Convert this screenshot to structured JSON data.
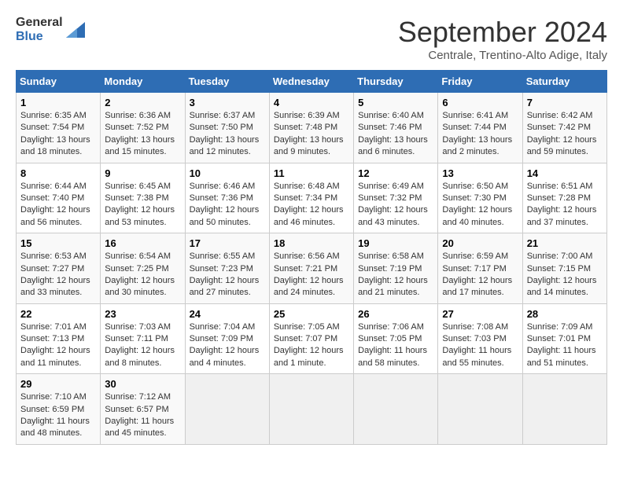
{
  "header": {
    "logo_line1": "General",
    "logo_line2": "Blue",
    "month": "September 2024",
    "location": "Centrale, Trentino-Alto Adige, Italy"
  },
  "columns": [
    "Sunday",
    "Monday",
    "Tuesday",
    "Wednesday",
    "Thursday",
    "Friday",
    "Saturday"
  ],
  "weeks": [
    [
      {
        "day": "1",
        "detail": "Sunrise: 6:35 AM\nSunset: 7:54 PM\nDaylight: 13 hours\nand 18 minutes."
      },
      {
        "day": "2",
        "detail": "Sunrise: 6:36 AM\nSunset: 7:52 PM\nDaylight: 13 hours\nand 15 minutes."
      },
      {
        "day": "3",
        "detail": "Sunrise: 6:37 AM\nSunset: 7:50 PM\nDaylight: 13 hours\nand 12 minutes."
      },
      {
        "day": "4",
        "detail": "Sunrise: 6:39 AM\nSunset: 7:48 PM\nDaylight: 13 hours\nand 9 minutes."
      },
      {
        "day": "5",
        "detail": "Sunrise: 6:40 AM\nSunset: 7:46 PM\nDaylight: 13 hours\nand 6 minutes."
      },
      {
        "day": "6",
        "detail": "Sunrise: 6:41 AM\nSunset: 7:44 PM\nDaylight: 13 hours\nand 2 minutes."
      },
      {
        "day": "7",
        "detail": "Sunrise: 6:42 AM\nSunset: 7:42 PM\nDaylight: 12 hours\nand 59 minutes."
      }
    ],
    [
      {
        "day": "8",
        "detail": "Sunrise: 6:44 AM\nSunset: 7:40 PM\nDaylight: 12 hours\nand 56 minutes."
      },
      {
        "day": "9",
        "detail": "Sunrise: 6:45 AM\nSunset: 7:38 PM\nDaylight: 12 hours\nand 53 minutes."
      },
      {
        "day": "10",
        "detail": "Sunrise: 6:46 AM\nSunset: 7:36 PM\nDaylight: 12 hours\nand 50 minutes."
      },
      {
        "day": "11",
        "detail": "Sunrise: 6:48 AM\nSunset: 7:34 PM\nDaylight: 12 hours\nand 46 minutes."
      },
      {
        "day": "12",
        "detail": "Sunrise: 6:49 AM\nSunset: 7:32 PM\nDaylight: 12 hours\nand 43 minutes."
      },
      {
        "day": "13",
        "detail": "Sunrise: 6:50 AM\nSunset: 7:30 PM\nDaylight: 12 hours\nand 40 minutes."
      },
      {
        "day": "14",
        "detail": "Sunrise: 6:51 AM\nSunset: 7:28 PM\nDaylight: 12 hours\nand 37 minutes."
      }
    ],
    [
      {
        "day": "15",
        "detail": "Sunrise: 6:53 AM\nSunset: 7:27 PM\nDaylight: 12 hours\nand 33 minutes."
      },
      {
        "day": "16",
        "detail": "Sunrise: 6:54 AM\nSunset: 7:25 PM\nDaylight: 12 hours\nand 30 minutes."
      },
      {
        "day": "17",
        "detail": "Sunrise: 6:55 AM\nSunset: 7:23 PM\nDaylight: 12 hours\nand 27 minutes."
      },
      {
        "day": "18",
        "detail": "Sunrise: 6:56 AM\nSunset: 7:21 PM\nDaylight: 12 hours\nand 24 minutes."
      },
      {
        "day": "19",
        "detail": "Sunrise: 6:58 AM\nSunset: 7:19 PM\nDaylight: 12 hours\nand 21 minutes."
      },
      {
        "day": "20",
        "detail": "Sunrise: 6:59 AM\nSunset: 7:17 PM\nDaylight: 12 hours\nand 17 minutes."
      },
      {
        "day": "21",
        "detail": "Sunrise: 7:00 AM\nSunset: 7:15 PM\nDaylight: 12 hours\nand 14 minutes."
      }
    ],
    [
      {
        "day": "22",
        "detail": "Sunrise: 7:01 AM\nSunset: 7:13 PM\nDaylight: 12 hours\nand 11 minutes."
      },
      {
        "day": "23",
        "detail": "Sunrise: 7:03 AM\nSunset: 7:11 PM\nDaylight: 12 hours\nand 8 minutes."
      },
      {
        "day": "24",
        "detail": "Sunrise: 7:04 AM\nSunset: 7:09 PM\nDaylight: 12 hours\nand 4 minutes."
      },
      {
        "day": "25",
        "detail": "Sunrise: 7:05 AM\nSunset: 7:07 PM\nDaylight: 12 hours\nand 1 minute."
      },
      {
        "day": "26",
        "detail": "Sunrise: 7:06 AM\nSunset: 7:05 PM\nDaylight: 11 hours\nand 58 minutes."
      },
      {
        "day": "27",
        "detail": "Sunrise: 7:08 AM\nSunset: 7:03 PM\nDaylight: 11 hours\nand 55 minutes."
      },
      {
        "day": "28",
        "detail": "Sunrise: 7:09 AM\nSunset: 7:01 PM\nDaylight: 11 hours\nand 51 minutes."
      }
    ],
    [
      {
        "day": "29",
        "detail": "Sunrise: 7:10 AM\nSunset: 6:59 PM\nDaylight: 11 hours\nand 48 minutes."
      },
      {
        "day": "30",
        "detail": "Sunrise: 7:12 AM\nSunset: 6:57 PM\nDaylight: 11 hours\nand 45 minutes."
      },
      {
        "day": "",
        "detail": ""
      },
      {
        "day": "",
        "detail": ""
      },
      {
        "day": "",
        "detail": ""
      },
      {
        "day": "",
        "detail": ""
      },
      {
        "day": "",
        "detail": ""
      }
    ]
  ]
}
